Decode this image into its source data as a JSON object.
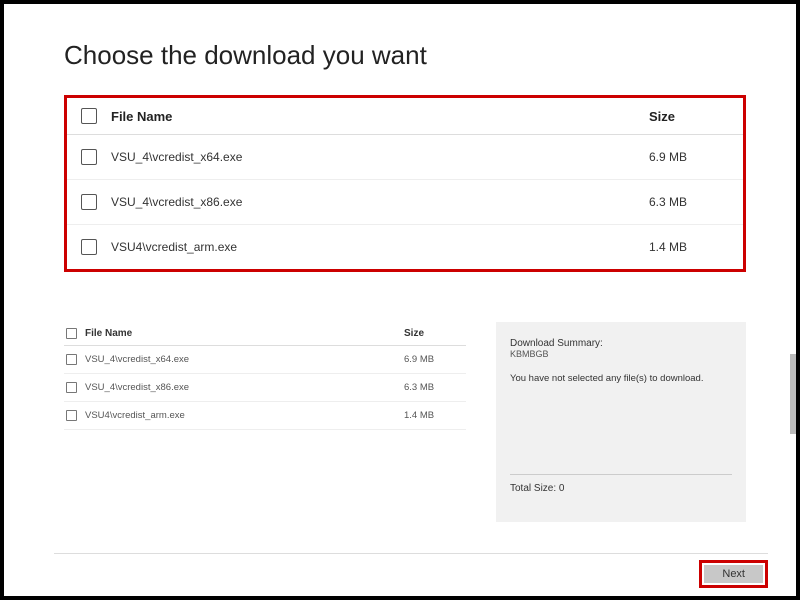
{
  "title": "Choose the download you want",
  "columns": {
    "name": "File Name",
    "size": "Size"
  },
  "files": [
    {
      "name": "VSU_4\\vcredist_x64.exe",
      "size": "6.9 MB"
    },
    {
      "name": "VSU_4\\vcredist_x86.exe",
      "size": "6.3 MB"
    },
    {
      "name": "VSU4\\vcredist_arm.exe",
      "size": "1.4 MB"
    }
  ],
  "summary": {
    "title": "Download Summary:",
    "units": "KBMBGB",
    "message": "You have not selected any file(s) to download.",
    "total_label": "Total Size: 0"
  },
  "buttons": {
    "next": "Next"
  }
}
